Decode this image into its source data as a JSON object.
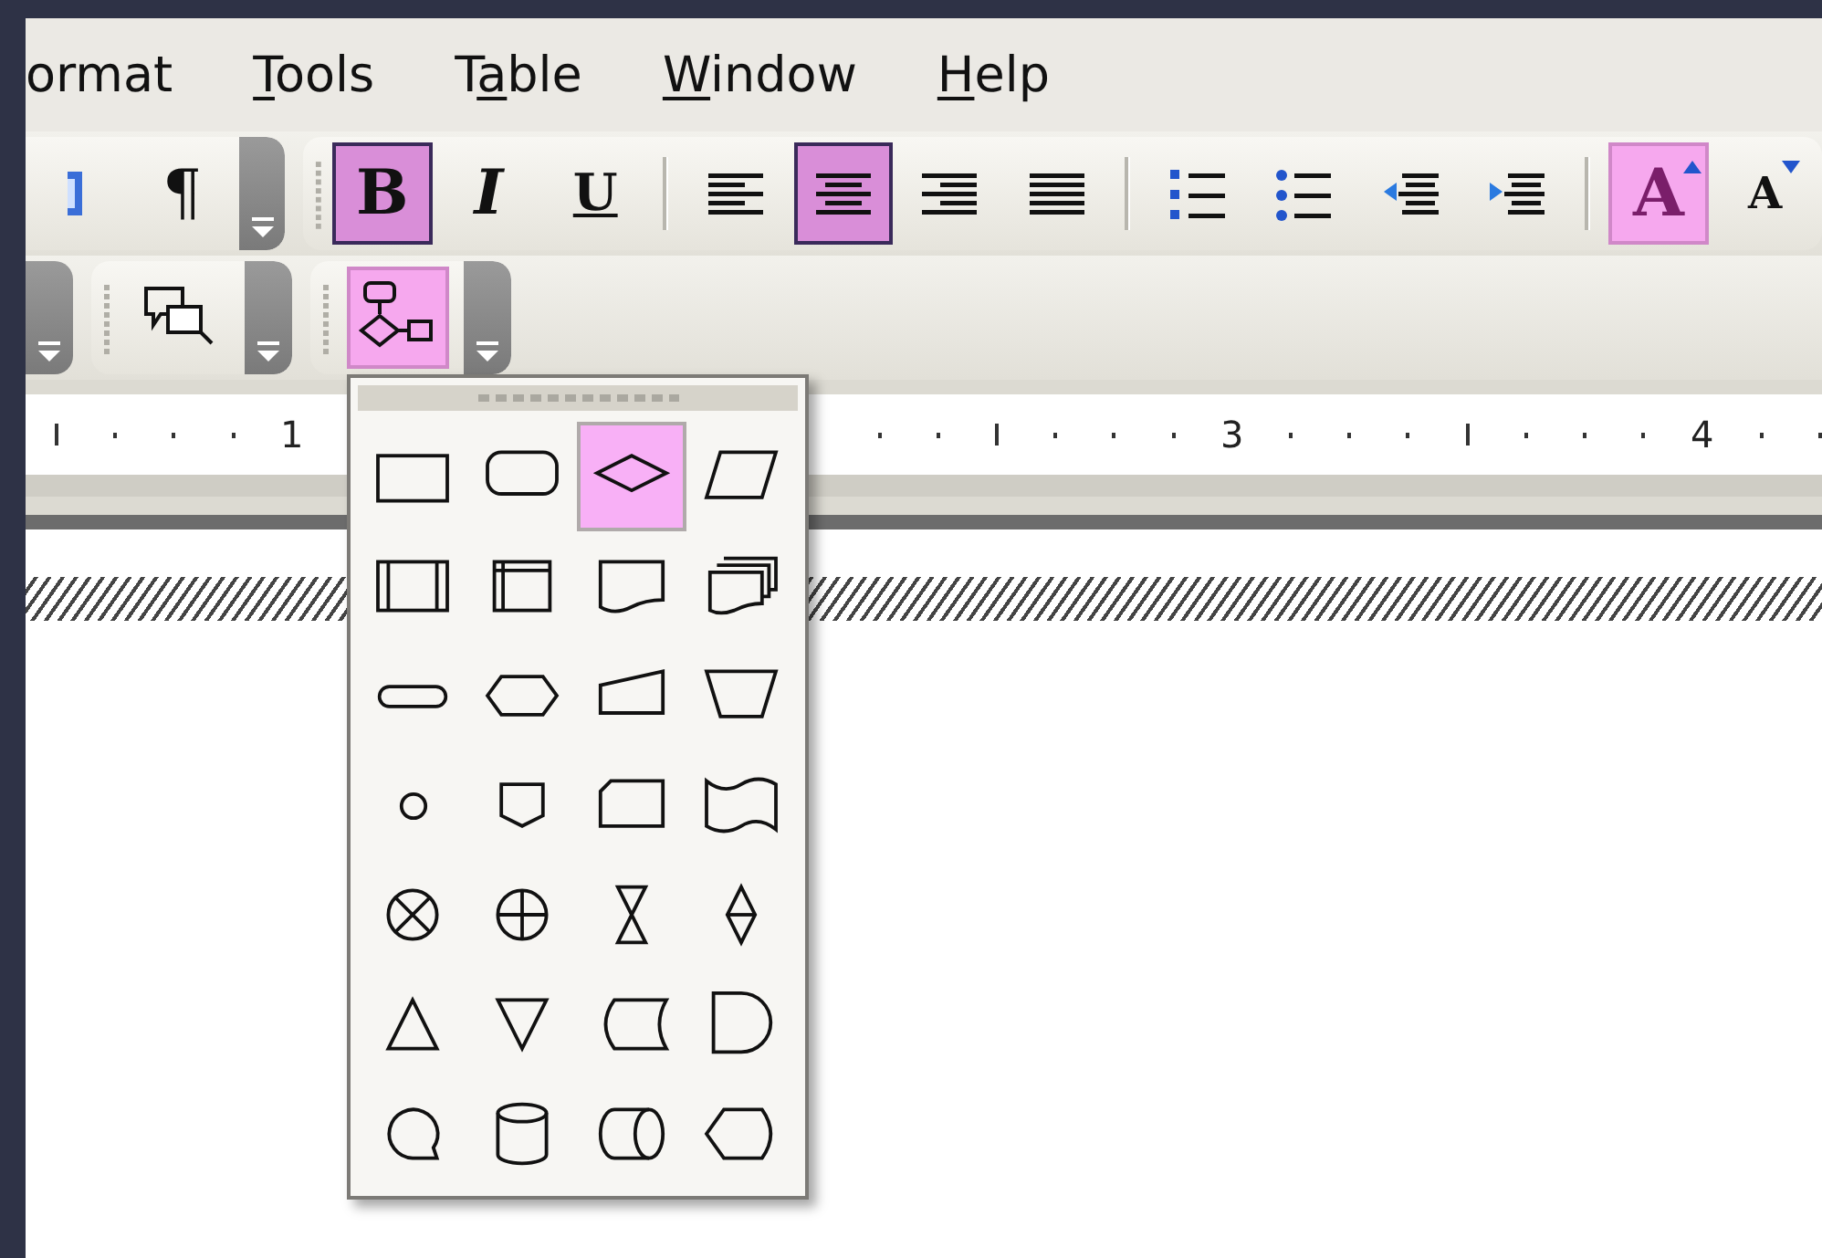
{
  "menu": [
    {
      "post": "ormat"
    },
    {
      "key": "T",
      "post": "ools"
    },
    {
      "pre": "T",
      "key": "a",
      "post": "ble"
    },
    {
      "key": "W",
      "post": "indow"
    },
    {
      "key": "H",
      "post": "elp"
    }
  ],
  "toolbar_row_1": [
    {
      "kind": "partial",
      "items": [
        {
          "kind": "blue-icon",
          "selected": false
        },
        {
          "kind": "pilcrow",
          "label": "¶",
          "selected": false
        }
      ]
    },
    {
      "kind": "formatting",
      "items": [
        {
          "kind": "bold",
          "label": "B",
          "selected": true
        },
        {
          "kind": "italic",
          "label": "I",
          "selected": false
        },
        {
          "kind": "underline",
          "label": "U",
          "selected": false
        },
        {
          "kind": "separator"
        },
        {
          "kind": "align-left",
          "selected": false
        },
        {
          "kind": "align-center",
          "selected": true
        },
        {
          "kind": "align-right",
          "selected": false
        },
        {
          "kind": "justify",
          "selected": false
        },
        {
          "kind": "separator"
        },
        {
          "kind": "numbering",
          "selected": false
        },
        {
          "kind": "bullets",
          "selected": false
        },
        {
          "kind": "outdent",
          "selected": false
        },
        {
          "kind": "indent",
          "selected": false
        },
        {
          "kind": "separator"
        },
        {
          "kind": "grow-font",
          "label": "A",
          "selected": true
        },
        {
          "kind": "shrink-font",
          "label": "A",
          "selected": false
        }
      ]
    }
  ],
  "toolbar_row_2": [
    {
      "kind": "partial"
    },
    {
      "kind": "callouts",
      "items": [
        {
          "kind": "callout",
          "selected": false
        }
      ]
    },
    {
      "kind": "flowchart",
      "items": [
        {
          "kind": "flowchart",
          "selected": true
        }
      ]
    }
  ],
  "ruler": {
    "labels": [
      "1",
      "3",
      "4"
    ]
  },
  "flowchart_menu": {
    "shapes": [
      {
        "kind": "process",
        "selected": false
      },
      {
        "kind": "alternate-process",
        "selected": false
      },
      {
        "kind": "decision",
        "selected": true
      },
      {
        "kind": "data",
        "selected": false
      },
      {
        "kind": "predefined-process",
        "selected": false
      },
      {
        "kind": "internal-storage",
        "selected": false
      },
      {
        "kind": "document",
        "selected": false
      },
      {
        "kind": "multidocument",
        "selected": false
      },
      {
        "kind": "terminator",
        "selected": false
      },
      {
        "kind": "preparation",
        "selected": false
      },
      {
        "kind": "manual-input",
        "selected": false
      },
      {
        "kind": "manual-operation",
        "selected": false
      },
      {
        "kind": "connector",
        "selected": false
      },
      {
        "kind": "off-page-connector",
        "selected": false
      },
      {
        "kind": "card",
        "selected": false
      },
      {
        "kind": "punched-tape",
        "selected": false
      },
      {
        "kind": "summing-junction",
        "selected": false
      },
      {
        "kind": "or",
        "selected": false
      },
      {
        "kind": "collate",
        "selected": false
      },
      {
        "kind": "sort",
        "selected": false
      },
      {
        "kind": "extract",
        "selected": false
      },
      {
        "kind": "merge",
        "selected": false
      },
      {
        "kind": "stored-data",
        "selected": false
      },
      {
        "kind": "delay",
        "selected": false
      },
      {
        "kind": "sequential-access-storage",
        "selected": false
      },
      {
        "kind": "magnetic-disk",
        "selected": false
      },
      {
        "kind": "direct-access-storage",
        "selected": false
      },
      {
        "kind": "display",
        "selected": false
      }
    ]
  }
}
